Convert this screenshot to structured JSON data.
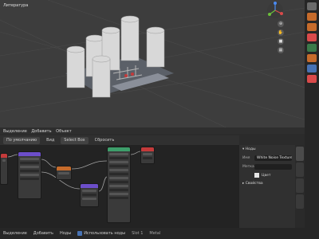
{
  "window": {
    "title": "Литература"
  },
  "viewport": {
    "header_items": [
      "Выделение",
      "Добавить",
      "Объект"
    ]
  },
  "node_editor": {
    "header": {
      "mode": "По умолчанию",
      "view": "Вид",
      "select": "Select Box",
      "extra": "Сбросить"
    }
  },
  "sidebar": {
    "section_node": "Ноды",
    "name_label": "Имя",
    "name_value": "White Noise Texture",
    "label_label": "Метка",
    "color_label": "Цвет",
    "section_props": "Свойства"
  },
  "statusbar": {
    "items": [
      "Выделение",
      "Добавить",
      "Ноды"
    ],
    "use_nodes_label": "Использовать ноды",
    "slot": "Slot 1",
    "material": "Metal"
  },
  "colors": {
    "accent": "#4772b3",
    "node_green": "#3d9e6a",
    "node_purple": "#6c4ec9",
    "node_orange": "#c66b2b",
    "node_red": "#c43a3a"
  }
}
